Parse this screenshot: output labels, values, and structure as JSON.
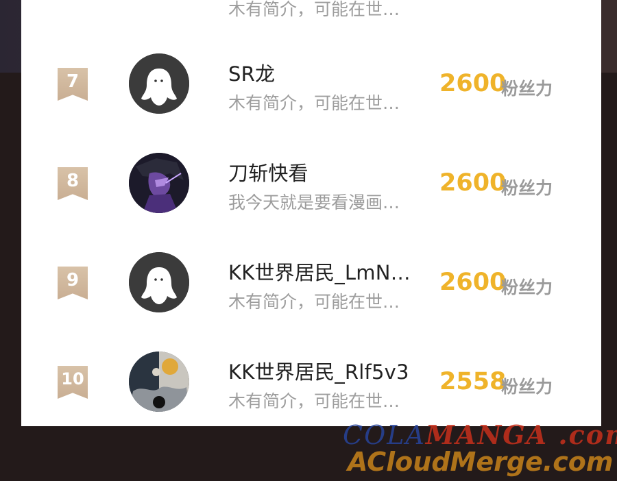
{
  "ranking": {
    "partial_row": {
      "bio": "木有简介，可能在世…"
    },
    "rows": [
      {
        "rank": "7",
        "name": "SR龙",
        "bio": "木有简介，可能在世…",
        "score": "2600",
        "unit": "粉丝力",
        "avatar": "default-avatar"
      },
      {
        "rank": "8",
        "name": "刀斩快看",
        "bio": "我今天就是要看漫画…",
        "score": "2600",
        "unit": "粉丝力",
        "avatar": "dark-character-avatar"
      },
      {
        "rank": "9",
        "name": "KK世界居民_LmN…",
        "bio": "木有简介，可能在世…",
        "score": "2600",
        "unit": "粉丝力",
        "avatar": "default-avatar"
      },
      {
        "rank": "10",
        "name": "KK世界居民_Rlf5v3",
        "bio": "木有简介，可能在世…",
        "score": "2558",
        "unit": "粉丝力",
        "avatar": "yin-yang-avatar"
      }
    ]
  },
  "watermark": {
    "line1_a": "COLA",
    "line1_b": "MANGA .com",
    "line2": "ACloudMerge.com"
  },
  "colors": {
    "score": "#efb32a",
    "badge": "#cfb597",
    "bio": "#9c9c9c"
  }
}
